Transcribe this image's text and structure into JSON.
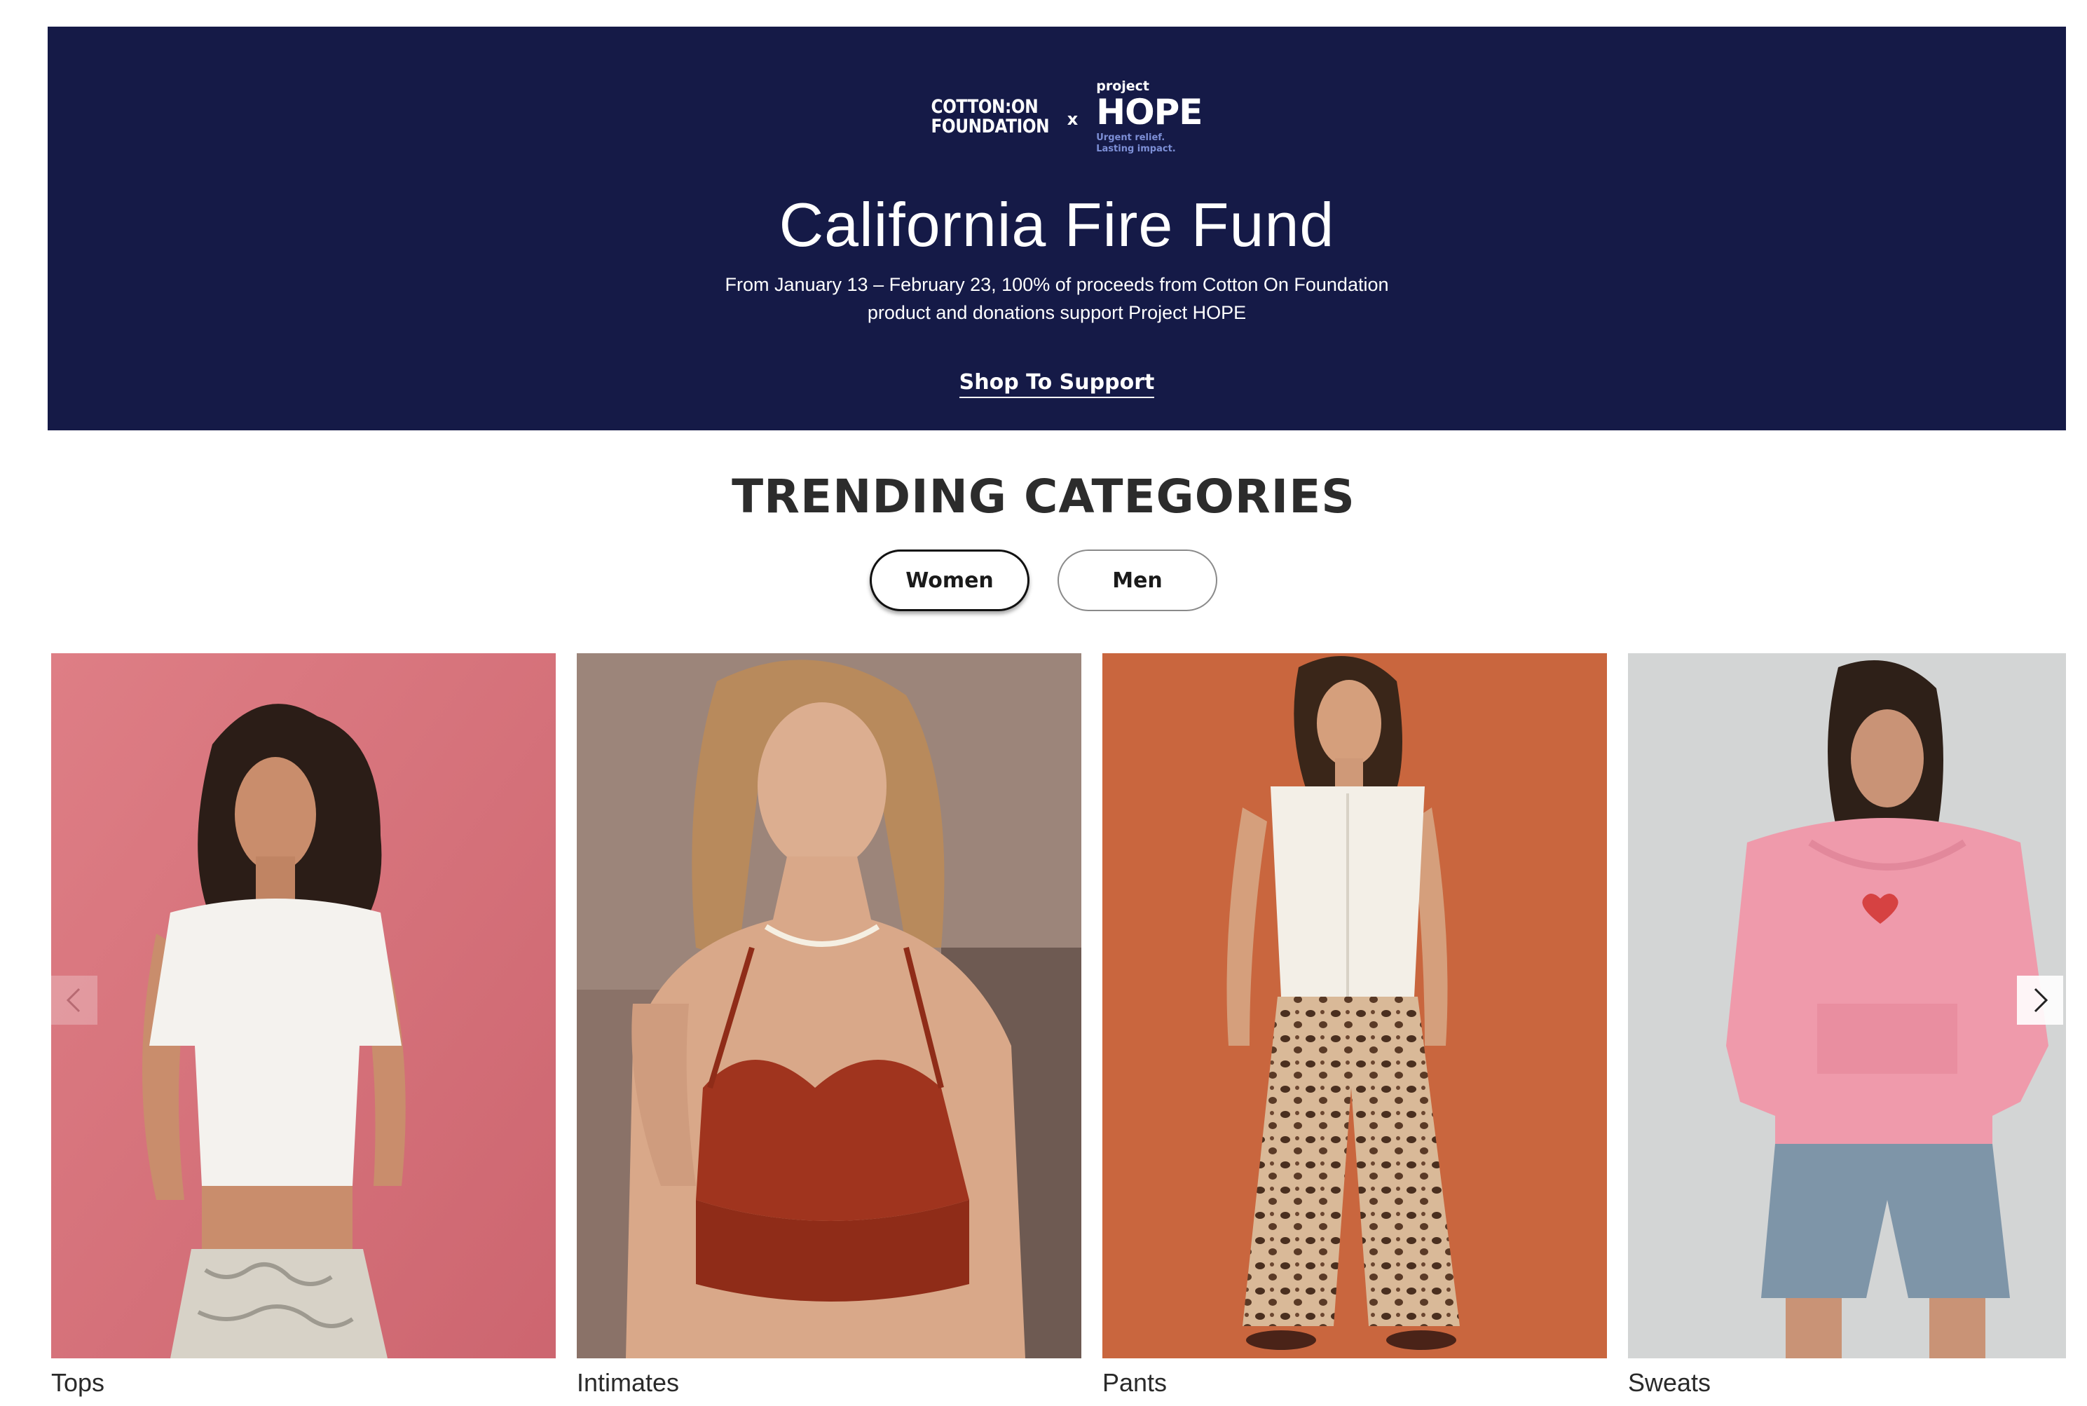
{
  "banner": {
    "logo_cotton_line1": "COTTON:ON",
    "logo_cotton_line2": "FOUNDATION",
    "logo_x": "x",
    "logo_project": "project",
    "logo_hope": "HOPE",
    "logo_tag_line1": "Urgent relief.",
    "logo_tag_line2": "Lasting impact.",
    "title": "California Fire Fund",
    "description_line1": "From January 13 – February 23, 100% of proceeds from Cotton On Foundation",
    "description_line2": "product and donations support Project HOPE",
    "cta": "Shop To Support",
    "bg_color": "#151a47"
  },
  "trending": {
    "title": "TRENDING CATEGORIES",
    "tabs": [
      {
        "label": "Women",
        "active": true
      },
      {
        "label": "Men",
        "active": false
      }
    ],
    "categories": [
      {
        "label": "Tops",
        "image": "woman-white-crop-tee-pink-backdrop"
      },
      {
        "label": "Intimates",
        "image": "woman-red-lace-bralette"
      },
      {
        "label": "Pants",
        "image": "woman-leopard-print-pants-orange-backdrop"
      },
      {
        "label": "Sweats",
        "image": "woman-pink-hoodie-denim-shorts"
      }
    ],
    "prev_icon": "chevron-left-icon",
    "next_icon": "chevron-right-icon"
  }
}
